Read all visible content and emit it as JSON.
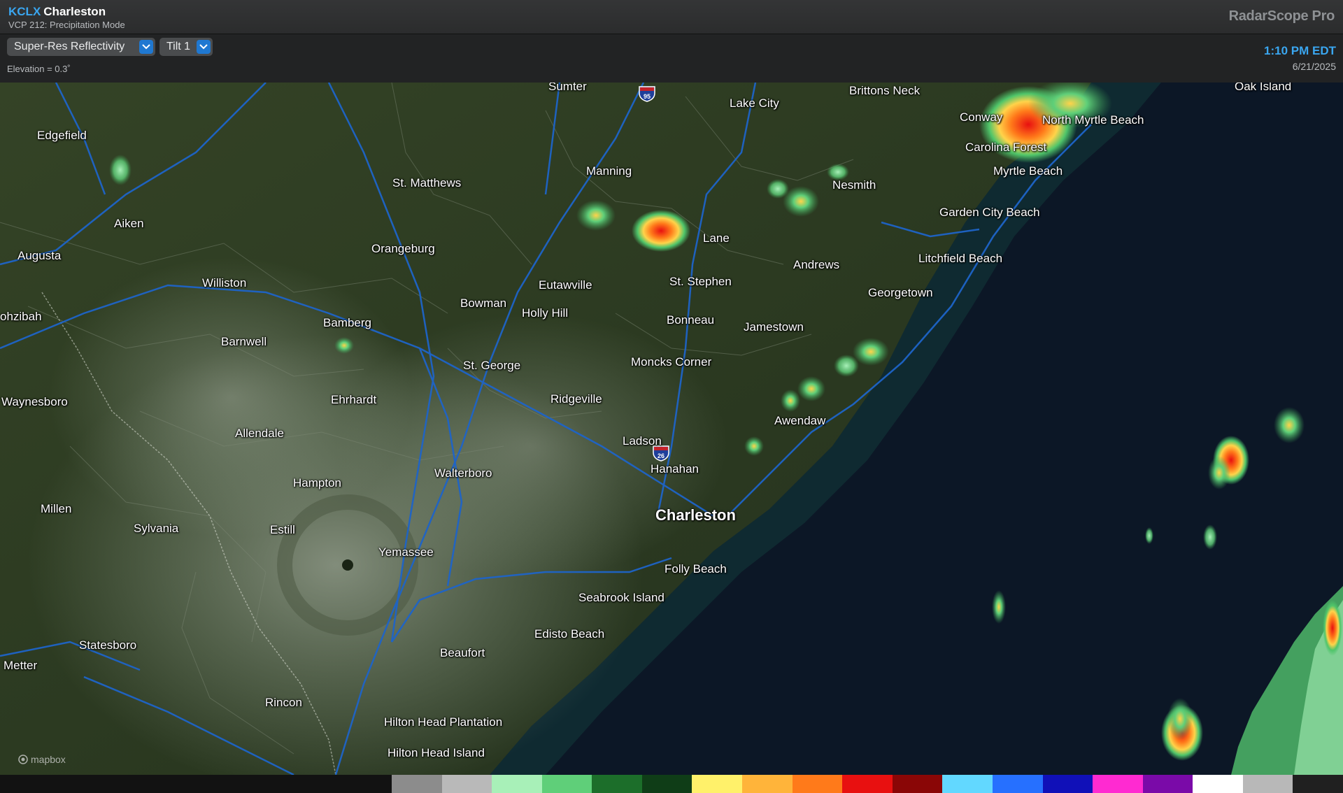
{
  "header": {
    "station_code": "KCLX",
    "station_name": "Charleston",
    "vcp": "VCP 212: Precipitation Mode",
    "brand": "RadarScope Pro",
    "time": "1:10 PM EDT",
    "date": "6/21/2025"
  },
  "toolbar": {
    "product": "Super-Res Reflectivity",
    "tilt": "Tilt 1",
    "elevation": "Elevation = 0.3˚"
  },
  "map": {
    "attribution": "mapbox",
    "shields": [
      "95",
      "26"
    ],
    "places": [
      {
        "id": "sumter",
        "name": "Sumter"
      },
      {
        "id": "lake-city",
        "name": "Lake City"
      },
      {
        "id": "brittons-neck",
        "name": "Brittons Neck"
      },
      {
        "id": "oak-island",
        "name": "Oak Island"
      },
      {
        "id": "conway",
        "name": "Conway"
      },
      {
        "id": "north-myrtle-beach",
        "name": "North Myrtle Beach"
      },
      {
        "id": "carolina-forest",
        "name": "Carolina Forest"
      },
      {
        "id": "myrtle-beach",
        "name": "Myrtle Beach"
      },
      {
        "id": "edgefield",
        "name": "Edgefield"
      },
      {
        "id": "st-matthews",
        "name": "St. Matthews"
      },
      {
        "id": "manning",
        "name": "Manning"
      },
      {
        "id": "nesmith",
        "name": "Nesmith"
      },
      {
        "id": "garden-city-beach",
        "name": "Garden City Beach"
      },
      {
        "id": "aiken",
        "name": "Aiken"
      },
      {
        "id": "lane",
        "name": "Lane"
      },
      {
        "id": "augusta",
        "name": "Augusta"
      },
      {
        "id": "orangeburg",
        "name": "Orangeburg"
      },
      {
        "id": "litchfield-beach",
        "name": "Litchfield Beach"
      },
      {
        "id": "andrews",
        "name": "Andrews"
      },
      {
        "id": "williston",
        "name": "Williston"
      },
      {
        "id": "eutawville",
        "name": "Eutawville"
      },
      {
        "id": "st-stephen",
        "name": "St. Stephen"
      },
      {
        "id": "georgetown",
        "name": "Georgetown"
      },
      {
        "id": "bowman",
        "name": "Bowman"
      },
      {
        "id": "hephzibah",
        "name": "ohzibah"
      },
      {
        "id": "holly-hill",
        "name": "Holly Hill"
      },
      {
        "id": "bamberg",
        "name": "Bamberg"
      },
      {
        "id": "bonneau",
        "name": "Bonneau"
      },
      {
        "id": "jamestown",
        "name": "Jamestown"
      },
      {
        "id": "barnwell",
        "name": "Barnwell"
      },
      {
        "id": "moncks-corner",
        "name": "Moncks Corner"
      },
      {
        "id": "st-george",
        "name": "St. George"
      },
      {
        "id": "ridgeville",
        "name": "Ridgeville"
      },
      {
        "id": "ehrhardt",
        "name": "Ehrhardt"
      },
      {
        "id": "waynesboro",
        "name": "Waynesboro"
      },
      {
        "id": "awendaw",
        "name": "Awendaw"
      },
      {
        "id": "allendale",
        "name": "Allendale"
      },
      {
        "id": "ladson",
        "name": "Ladson"
      },
      {
        "id": "hanahan",
        "name": "Hanahan"
      },
      {
        "id": "walterboro",
        "name": "Walterboro"
      },
      {
        "id": "hampton",
        "name": "Hampton"
      },
      {
        "id": "millen",
        "name": "Millen"
      },
      {
        "id": "charleston",
        "name": "Charleston",
        "big": true
      },
      {
        "id": "sylvania",
        "name": "Sylvania"
      },
      {
        "id": "estill",
        "name": "Estill"
      },
      {
        "id": "yemassee",
        "name": "Yemassee"
      },
      {
        "id": "folly-beach",
        "name": "Folly Beach"
      },
      {
        "id": "seabrook-island",
        "name": "Seabrook Island"
      },
      {
        "id": "edisto-beach",
        "name": "Edisto Beach"
      },
      {
        "id": "statesboro",
        "name": "Statesboro"
      },
      {
        "id": "beaufort",
        "name": "Beaufort"
      },
      {
        "id": "metter",
        "name": "Metter"
      },
      {
        "id": "rincon",
        "name": "Rincon"
      },
      {
        "id": "hilton-head-plantation",
        "name": "Hilton Head Plantation"
      },
      {
        "id": "hilton-head-island",
        "name": "Hilton Head Island"
      }
    ]
  },
  "colors": {
    "accent": "#3aa6f0",
    "land": "#2d3a22",
    "ocean": "#0c1726",
    "legend": [
      "#8c8c8c",
      "#b9b9b9",
      "#a8f0b8",
      "#5fcf79",
      "#1c6e2a",
      "#0f3d17",
      "#fff16a",
      "#ffb43a",
      "#ff7a1a",
      "#e81010",
      "#8a0606",
      "#62d8ff",
      "#2670ff",
      "#1010b8",
      "#ff2ad1",
      "#7a0aa8",
      "#ffffff",
      "#b8b8b8",
      "#202020"
    ]
  }
}
